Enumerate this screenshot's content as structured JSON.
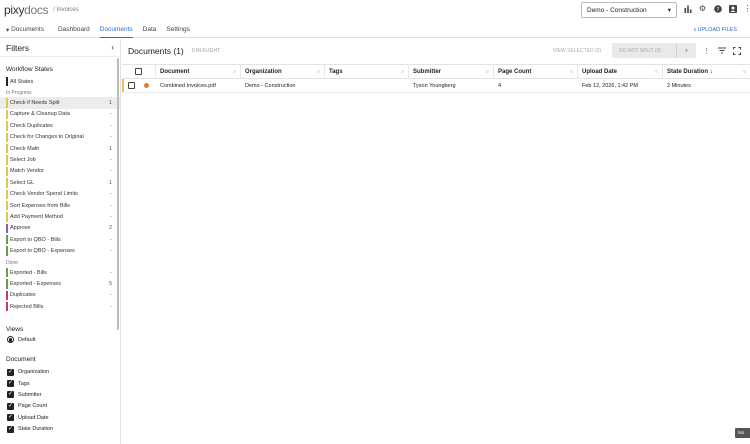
{
  "app": {
    "logo_left": "pixy",
    "logo_right": "docs",
    "breadcrumb": "/ Invoices",
    "project": "Demo - Construction"
  },
  "nav": {
    "documents_menu": "Documents",
    "tabs": [
      "Dashboard",
      "Documents",
      "Data",
      "Settings"
    ],
    "active": "Documents"
  },
  "filters": {
    "title": "Filters",
    "workflow_title": "Workflow States",
    "all_states": "All States",
    "in_progress_label": "In Progress",
    "done_label": "Done",
    "in_progress": [
      {
        "label": "Check if Needs Split",
        "count": "1",
        "color": "#e8c34a"
      },
      {
        "label": "Capture & Cleanup Data",
        "count": "-",
        "color": "#e8c34a"
      },
      {
        "label": "Check Duplicates",
        "count": "-",
        "color": "#e8c34a"
      },
      {
        "label": "Check for Changes to Original",
        "count": "-",
        "color": "#e8c34a"
      },
      {
        "label": "Check Math",
        "count": "1",
        "color": "#e8c34a"
      },
      {
        "label": "Select Job",
        "count": "-",
        "color": "#e8c34a"
      },
      {
        "label": "Match Vendor",
        "count": "-",
        "color": "#e8c34a"
      },
      {
        "label": "Select GL",
        "count": "1",
        "color": "#e8c34a"
      },
      {
        "label": "Check Vendor Spend Limits",
        "count": "-",
        "color": "#e8c34a"
      },
      {
        "label": "Sort Expenses from Bills",
        "count": "-",
        "color": "#e8c34a"
      },
      {
        "label": "Add Payment Method",
        "count": "-",
        "color": "#e8c34a"
      },
      {
        "label": "Approve",
        "count": "2",
        "color": "#8a5cc4"
      },
      {
        "label": "Export to QBO - Bills",
        "count": "-",
        "color": "#5aa34a"
      },
      {
        "label": "Export to QBO - Expenses",
        "count": "-",
        "color": "#5aa34a"
      }
    ],
    "done": [
      {
        "label": "Exported - Bills",
        "count": "-",
        "color": "#5aa34a"
      },
      {
        "label": "Exported - Expenses",
        "count": "5",
        "color": "#5aa34a"
      },
      {
        "label": "Duplicates",
        "count": "-",
        "color": "#c43c5c"
      },
      {
        "label": "Rejected Bills",
        "count": "-",
        "color": "#c43c5c"
      }
    ],
    "views_title": "Views",
    "view_default": "Default",
    "document_title": "Document",
    "columns": [
      "Organization",
      "Tags",
      "Submitter",
      "Page Count",
      "Upload Date",
      "State Duration"
    ]
  },
  "main": {
    "title": "Documents",
    "count": "(1)",
    "in_flight": "0 IN FLIGHT",
    "view_selected": "VIEW SELECTED (0)",
    "do_not_split": "DO NOT SPLIT (0)",
    "upload": "UPLOAD FILES",
    "headers": [
      "Document",
      "Organization",
      "Tags",
      "Submitter",
      "Page Count",
      "Upload Date",
      "State Duration"
    ],
    "rows": [
      {
        "document": "Combined Invoices.pdf",
        "organization": "Demo - Construction",
        "tags": "",
        "submitter": "Tyson Youngberg",
        "page_count": "4",
        "upload_date": "Feb 12, 2026, 1:42 PM",
        "state_duration": "2 Minutes"
      }
    ]
  },
  "tooltip": "Mo"
}
